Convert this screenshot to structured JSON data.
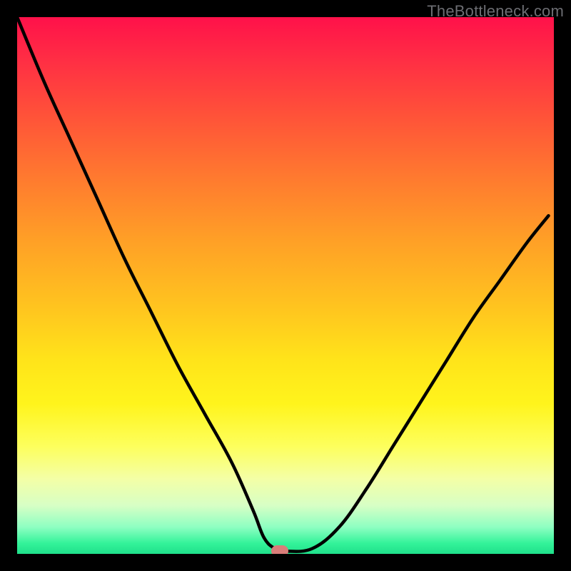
{
  "watermark": "TheBottleneck.com",
  "chart_data": {
    "type": "line",
    "title": "",
    "xlabel": "",
    "ylabel": "",
    "xlim": [
      0,
      100
    ],
    "ylim": [
      0,
      100
    ],
    "series": [
      {
        "name": "curve",
        "x": [
          0,
          5,
          10,
          15,
          20,
          25,
          30,
          35,
          40,
          44,
          46,
          48,
          50,
          55,
          60,
          65,
          70,
          75,
          80,
          85,
          90,
          95,
          99
        ],
        "y": [
          100,
          88,
          77,
          66,
          55,
          45,
          35,
          26,
          17,
          8,
          3,
          1,
          0.5,
          1,
          5,
          12,
          20,
          28,
          36,
          44,
          51,
          58,
          63
        ]
      }
    ],
    "marker": {
      "x": 49,
      "y": 0.5,
      "color": "#d97d79"
    },
    "gradient_stops": [
      {
        "pos": 0.0,
        "color": "#ff114a"
      },
      {
        "pos": 0.5,
        "color": "#ffc41f"
      },
      {
        "pos": 0.8,
        "color": "#fdff5d"
      },
      {
        "pos": 1.0,
        "color": "#1fe08b"
      }
    ]
  }
}
